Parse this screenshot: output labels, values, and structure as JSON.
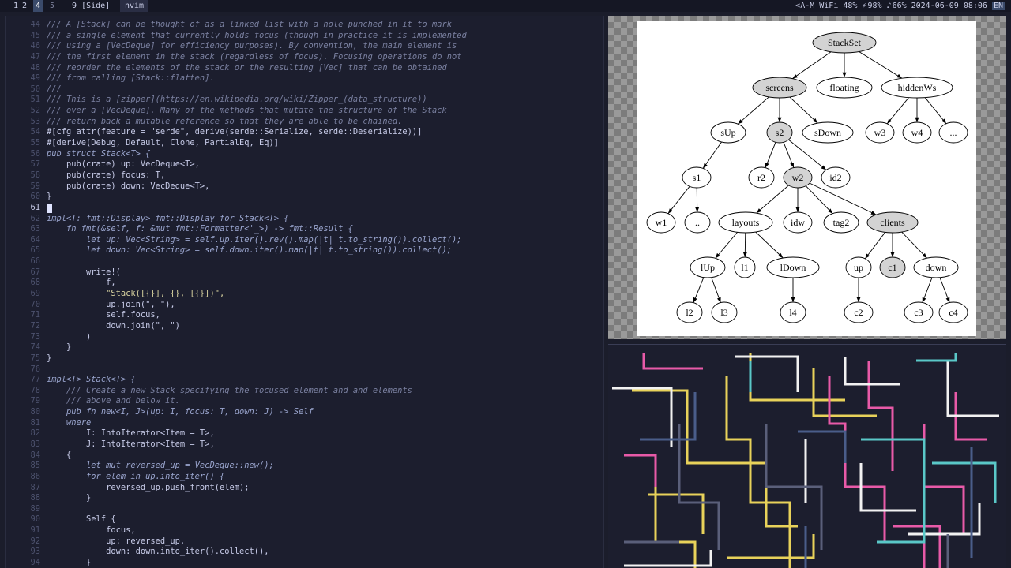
{
  "topbar": {
    "workspaces": [
      "1",
      "2",
      "4",
      "5",
      "9"
    ],
    "layout": "[Side]",
    "window_title": "nvim",
    "status": {
      "mode": "<A-M",
      "wifi": "WiFi 48%",
      "battery": "98%",
      "volume": "66%",
      "datetime": "2024-06-09 08:06",
      "lang": "EN"
    }
  },
  "editor": {
    "lines": [
      {
        "n": "44",
        "t": "/// A [Stack] can be thought of as a linked list with a hole punched in it to mark",
        "k": "cm"
      },
      {
        "n": "45",
        "t": "/// a single element that currently holds focus (though in practice it is implemented",
        "k": "cm"
      },
      {
        "n": "46",
        "t": "/// using a [VecDeque] for efficiency purposes). By convention, the main element is",
        "k": "cm"
      },
      {
        "n": "47",
        "t": "/// the first element in the stack (regardless of focus). Focusing operations do not",
        "k": "cm"
      },
      {
        "n": "48",
        "t": "/// reorder the elements of the stack or the resulting [Vec] that can be obtained",
        "k": "cm"
      },
      {
        "n": "49",
        "t": "/// from calling [Stack::flatten].",
        "k": "cm"
      },
      {
        "n": "50",
        "t": "///",
        "k": "cm"
      },
      {
        "n": "51",
        "t": "/// This is a [zipper](https://en.wikipedia.org/wiki/Zipper_(data_structure))",
        "k": "cm"
      },
      {
        "n": "52",
        "t": "/// over a [VecDeque]. Many of the methods that mutate the structure of the Stack",
        "k": "cm"
      },
      {
        "n": "53",
        "t": "/// return back a mutable reference so that they are able to be chained.",
        "k": "cm"
      },
      {
        "n": "54",
        "t": "#[cfg_attr(feature = \"serde\", derive(serde::Serialize, serde::Deserialize))]",
        "k": "mc"
      },
      {
        "n": "55",
        "t": "#[derive(Debug, Default, Clone, PartialEq, Eq)]",
        "k": "mc"
      },
      {
        "n": "56",
        "t": "pub struct Stack<T> {",
        "k": "kw"
      },
      {
        "n": "57",
        "t": "    pub(crate) up: VecDeque<T>,",
        "k": "ty"
      },
      {
        "n": "58",
        "t": "    pub(crate) focus: T,",
        "k": "ty"
      },
      {
        "n": "59",
        "t": "    pub(crate) down: VecDeque<T>,",
        "k": "ty"
      },
      {
        "n": "60",
        "t": "}",
        "k": "ty"
      },
      {
        "n": "61",
        "t": "",
        "k": "ty"
      },
      {
        "n": "62",
        "t": "impl<T: fmt::Display> fmt::Display for Stack<T> {",
        "k": "kw"
      },
      {
        "n": "63",
        "t": "    fn fmt(&self, f: &mut fmt::Formatter<'_>) -> fmt::Result {",
        "k": "kw"
      },
      {
        "n": "64",
        "t": "        let up: Vec<String> = self.up.iter().rev().map(|t| t.to_string()).collect();",
        "k": "kw"
      },
      {
        "n": "65",
        "t": "        let down: Vec<String> = self.down.iter().map(|t| t.to_string()).collect();",
        "k": "kw"
      },
      {
        "n": "66",
        "t": "",
        "k": "ty"
      },
      {
        "n": "67",
        "t": "        write!(",
        "k": "ty"
      },
      {
        "n": "68",
        "t": "            f,",
        "k": "ty"
      },
      {
        "n": "69",
        "t": "            \"Stack([{}], {}, [{}])\",",
        "k": "st"
      },
      {
        "n": "70",
        "t": "            up.join(\", \"),",
        "k": "ty"
      },
      {
        "n": "71",
        "t": "            self.focus,",
        "k": "ty"
      },
      {
        "n": "72",
        "t": "            down.join(\", \")",
        "k": "ty"
      },
      {
        "n": "73",
        "t": "        )",
        "k": "ty"
      },
      {
        "n": "74",
        "t": "    }",
        "k": "ty"
      },
      {
        "n": "75",
        "t": "}",
        "k": "ty"
      },
      {
        "n": "76",
        "t": "",
        "k": "ty"
      },
      {
        "n": "77",
        "t": "impl<T> Stack<T> {",
        "k": "kw"
      },
      {
        "n": "78",
        "t": "    /// Create a new Stack specifying the focused element and and elements",
        "k": "cm"
      },
      {
        "n": "79",
        "t": "    /// above and below it.",
        "k": "cm"
      },
      {
        "n": "80",
        "t": "    pub fn new<I, J>(up: I, focus: T, down: J) -> Self",
        "k": "kw"
      },
      {
        "n": "81",
        "t": "    where",
        "k": "kw"
      },
      {
        "n": "82",
        "t": "        I: IntoIterator<Item = T>,",
        "k": "ty"
      },
      {
        "n": "83",
        "t": "        J: IntoIterator<Item = T>,",
        "k": "ty"
      },
      {
        "n": "84",
        "t": "    {",
        "k": "ty"
      },
      {
        "n": "85",
        "t": "        let mut reversed_up = VecDeque::new();",
        "k": "kw"
      },
      {
        "n": "86",
        "t": "        for elem in up.into_iter() {",
        "k": "kw"
      },
      {
        "n": "87",
        "t": "            reversed_up.push_front(elem);",
        "k": "ty"
      },
      {
        "n": "88",
        "t": "        }",
        "k": "ty"
      },
      {
        "n": "89",
        "t": "",
        "k": "ty"
      },
      {
        "n": "90",
        "t": "        Self {",
        "k": "ty"
      },
      {
        "n": "91",
        "t": "            focus,",
        "k": "ty"
      },
      {
        "n": "92",
        "t": "            up: reversed_up,",
        "k": "ty"
      },
      {
        "n": "93",
        "t": "            down: down.into_iter().collect(),",
        "k": "ty"
      },
      {
        "n": "94",
        "t": "        }",
        "k": "ty"
      }
    ]
  },
  "graph": {
    "nodes": [
      {
        "id": "StackSet",
        "label": "StackSet",
        "focus": true
      },
      {
        "id": "screens",
        "label": "screens",
        "focus": true
      },
      {
        "id": "floating",
        "label": "floating",
        "focus": false
      },
      {
        "id": "hiddenWs",
        "label": "hiddenWs",
        "focus": false
      },
      {
        "id": "sUp",
        "label": "sUp",
        "focus": false
      },
      {
        "id": "s2",
        "label": "s2",
        "focus": true
      },
      {
        "id": "sDown",
        "label": "sDown",
        "focus": false
      },
      {
        "id": "w3",
        "label": "w3",
        "focus": false
      },
      {
        "id": "w4",
        "label": "w4",
        "focus": false
      },
      {
        "id": "hdots",
        "label": "...",
        "focus": false
      },
      {
        "id": "s1",
        "label": "s1",
        "focus": false
      },
      {
        "id": "r2",
        "label": "r2",
        "focus": false
      },
      {
        "id": "w2",
        "label": "w2",
        "focus": true
      },
      {
        "id": "id2",
        "label": "id2",
        "focus": false
      },
      {
        "id": "w1",
        "label": "w1",
        "focus": false
      },
      {
        "id": "dd",
        "label": "..",
        "focus": false
      },
      {
        "id": "layouts",
        "label": "layouts",
        "focus": false
      },
      {
        "id": "idw",
        "label": "idw",
        "focus": false
      },
      {
        "id": "tag2",
        "label": "tag2",
        "focus": false
      },
      {
        "id": "clients",
        "label": "clients",
        "focus": true
      },
      {
        "id": "lUp",
        "label": "lUp",
        "focus": false
      },
      {
        "id": "l1",
        "label": "l1",
        "focus": false
      },
      {
        "id": "lDown",
        "label": "lDown",
        "focus": false
      },
      {
        "id": "up",
        "label": "up",
        "focus": false
      },
      {
        "id": "c1",
        "label": "c1",
        "focus": true
      },
      {
        "id": "down",
        "label": "down",
        "focus": false
      },
      {
        "id": "l2",
        "label": "l2",
        "focus": false
      },
      {
        "id": "l3",
        "label": "l3",
        "focus": false
      },
      {
        "id": "l4",
        "label": "l4",
        "focus": false
      },
      {
        "id": "c2",
        "label": "c2",
        "focus": false
      },
      {
        "id": "c3",
        "label": "c3",
        "focus": false
      },
      {
        "id": "c4",
        "label": "c4",
        "focus": false
      }
    ],
    "edges": [
      [
        "StackSet",
        "screens"
      ],
      [
        "StackSet",
        "floating"
      ],
      [
        "StackSet",
        "hiddenWs"
      ],
      [
        "screens",
        "sUp"
      ],
      [
        "screens",
        "s2"
      ],
      [
        "screens",
        "sDown"
      ],
      [
        "hiddenWs",
        "w3"
      ],
      [
        "hiddenWs",
        "w4"
      ],
      [
        "hiddenWs",
        "hdots"
      ],
      [
        "sUp",
        "s1"
      ],
      [
        "s2",
        "r2"
      ],
      [
        "s2",
        "w2"
      ],
      [
        "s2",
        "id2"
      ],
      [
        "s1",
        "w1"
      ],
      [
        "s1",
        "dd"
      ],
      [
        "w2",
        "layouts"
      ],
      [
        "w2",
        "idw"
      ],
      [
        "w2",
        "tag2"
      ],
      [
        "w2",
        "clients"
      ],
      [
        "layouts",
        "lUp"
      ],
      [
        "layouts",
        "l1"
      ],
      [
        "layouts",
        "lDown"
      ],
      [
        "clients",
        "up"
      ],
      [
        "clients",
        "c1"
      ],
      [
        "clients",
        "down"
      ],
      [
        "lUp",
        "l2"
      ],
      [
        "lUp",
        "l3"
      ],
      [
        "lDown",
        "l4"
      ],
      [
        "up",
        "c2"
      ],
      [
        "down",
        "c3"
      ],
      [
        "down",
        "c4"
      ]
    ],
    "colors": {
      "focus_fill": "#d3d3d3",
      "node_fill": "#ffffff",
      "stroke": "#000000"
    }
  },
  "pipes": {
    "colors": [
      "#e8d25a",
      "#e85aa8",
      "#f2f2f2",
      "#5ac8c8",
      "#5a5f7a",
      "#4a5d8a"
    ]
  }
}
